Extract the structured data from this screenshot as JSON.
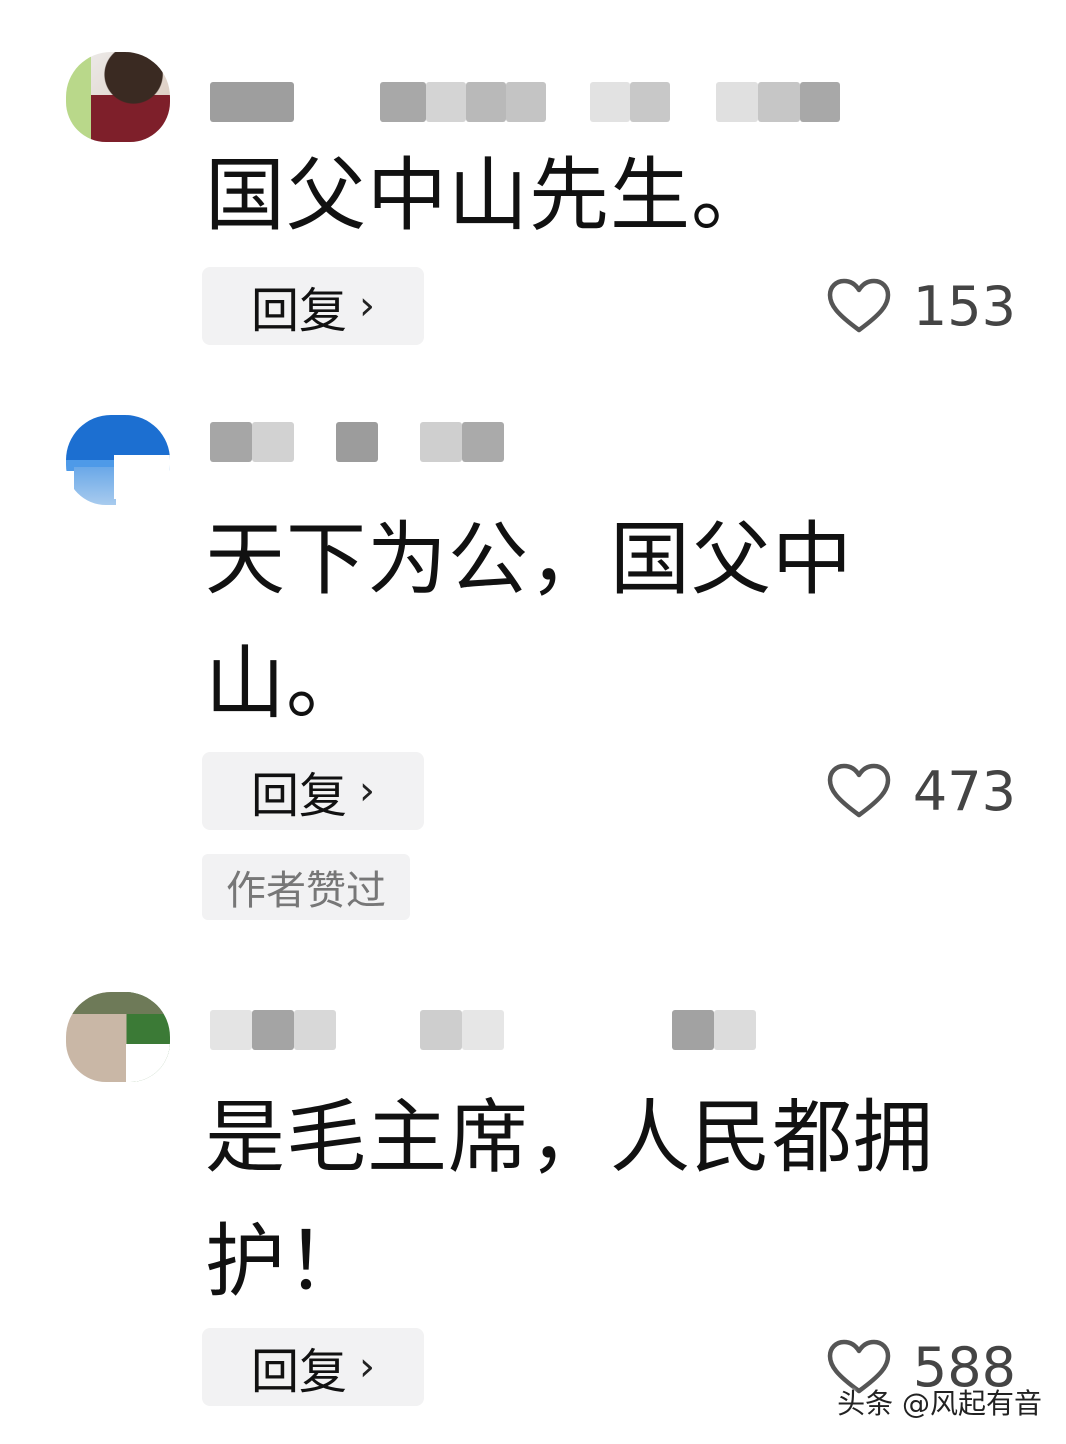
{
  "comments": [
    {
      "text": "国父中山先生。",
      "reply_label": "回复",
      "like_count": "153",
      "author_liked": ""
    },
    {
      "text": "天下为公，国父中山。",
      "reply_label": "回复",
      "like_count": "473",
      "author_liked": "作者赞过"
    },
    {
      "text": "是毛主席，人民都拥护！",
      "reply_label": "回复",
      "like_count": "588",
      "author_liked": ""
    }
  ],
  "icons": {
    "like": "heart-outline-icon",
    "reply_arrow": "chevron-right-icon"
  },
  "watermark": "头条 @风起有音",
  "colors": {
    "reply_bg": "#f2f2f3",
    "text": "#111111",
    "muted": "#777777"
  }
}
